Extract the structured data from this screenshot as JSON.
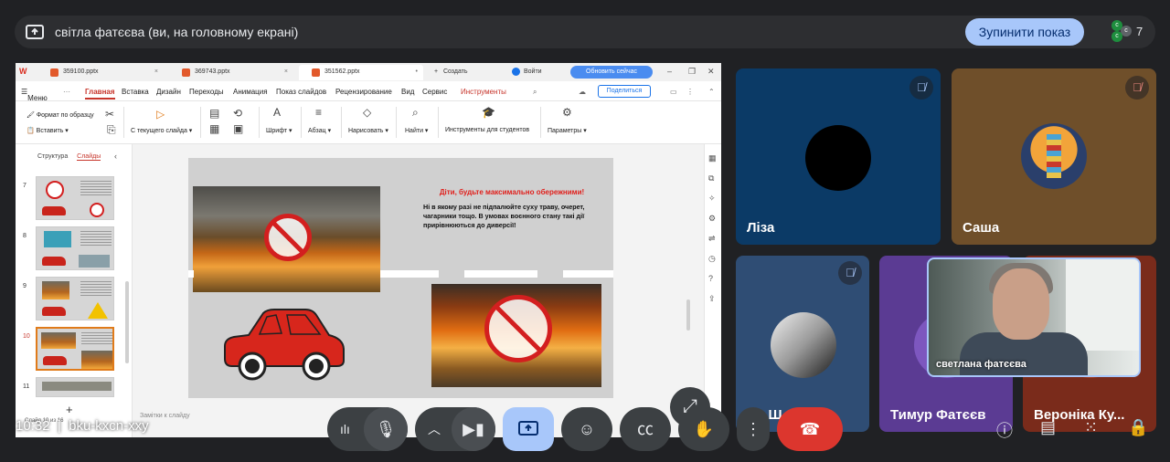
{
  "topbar": {
    "title": "світла фатєєва (ви, на головному екрані)",
    "stop_label": "Зупинити показ",
    "participants_count": "7",
    "participant_dots": [
      "с",
      "с",
      "с"
    ]
  },
  "app": {
    "tabs": [
      {
        "label": "359100.pptx",
        "active": false
      },
      {
        "label": "369743.pptx",
        "active": false
      },
      {
        "label": "351562.pptx",
        "active": true
      }
    ],
    "new_tab_label": "Создать",
    "login_label": "Войти",
    "update_label": "Обновить сейчас",
    "menu_label": "Меню",
    "menu_items": [
      "Главная",
      "Вставка",
      "Дизайн",
      "Переходы",
      "Анимация",
      "Показ слайдов",
      "Рецензирование",
      "Вид",
      "Сервис",
      "Инструменты"
    ],
    "share_label": "Поделиться",
    "ribbon": {
      "format_painter": "Формат по образцу",
      "paste": "Вставить",
      "from_current": "С текущего слайда",
      "font": "Шрифт",
      "paragraph": "Абзац",
      "draw": "Нарисовать",
      "find": "Найти",
      "student_tools": "Инструменты для студентов",
      "params": "Параметры"
    },
    "panel_tabs": [
      "Структура",
      "Слайды"
    ],
    "slide_numbers": [
      "7",
      "8",
      "9",
      "10",
      "11"
    ],
    "notes_placeholder": "Замітки к слайду",
    "status_text": "Слайд 10 из 16"
  },
  "slide": {
    "heading": "Діти, будьте максимально обережними!",
    "body": "Ні в якому разі не підпалюйте суху траву, очерет, чагарники тощо. В умовах воєнного стану такі дії прирівнюються до диверсії!"
  },
  "overlay": {
    "time": "10:32",
    "meeting_code": "bku-kxcn-xxy"
  },
  "participants": [
    {
      "name": "Ліза",
      "muted": true
    },
    {
      "name": "Саша",
      "muted": true
    },
    {
      "name": "Ля Ш...",
      "muted": true
    },
    {
      "name": "Тимур Фатєєв",
      "muted": false
    },
    {
      "name": "Вероніка Ку...",
      "muted": false
    }
  ],
  "self_view": {
    "name": "светлана фатєєва"
  },
  "colors": {
    "background": "#202124",
    "accent": "#a8c7fa",
    "end_call": "#dc362e",
    "ppt_active": "#c7352b"
  }
}
